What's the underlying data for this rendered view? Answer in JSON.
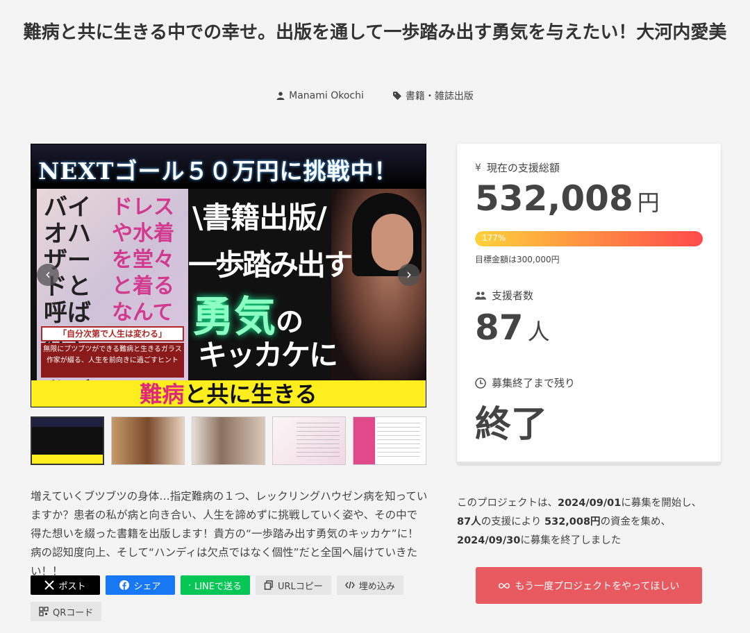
{
  "project": {
    "title": "難病と共に生きる中での幸せ。出版を通して一歩踏み出す勇気を与えたい！大河内愛美",
    "author": "Manami Okochi",
    "category": "書籍・雑誌出版"
  },
  "hero": {
    "top_text": "NEXTゴール５０万円に挑戦中！",
    "book_title_left": "バイオハザードと呼ばれていた私が",
    "book_title_right": "ドレスや水着を堂々と着るなんて",
    "book_banner": "「自分次第で人生は変わる」",
    "book_sub": "無限にブツブツができる難病と生きるガラス作家が綴る、人生を前向きに過ごすヒント",
    "line1": "\\書籍出版/",
    "line2": "一歩踏み出す",
    "line3": "勇気",
    "line3b": "の",
    "line4": "キッカケに",
    "bottom_red": "難病",
    "bottom_rest": "と共に生きる",
    "prev": "‹",
    "next": "›"
  },
  "stats": {
    "total_label": "現在の支援総額",
    "total_value": "532,008",
    "total_unit": "円",
    "progress_percent": 177,
    "progress_text": "177%",
    "target_text": "目標金額は300,000円",
    "backers_label": "支援者数",
    "backers_value": "87",
    "backers_unit": "人",
    "remaining_label": "募集終了まで残り",
    "remaining_value": "終了"
  },
  "summary": {
    "p1": "このプロジェクトは、",
    "start_date": "2024/09/01",
    "p2": "に募集を開始し、",
    "backers": "87人",
    "p3": "の支援により ",
    "amount": "532,008円",
    "p4": "の資金を集め、",
    "end_date": "2024/09/30",
    "p5": "に募集を終了しました"
  },
  "cta_label": "もう一度プロジェクトをやってほしい",
  "description": "増えていくブツブツの身体…指定難病の１つ、レックリングハウゼン病を知っていますか？患者の私が病と向き合い、人生を諦めずに挑戦していく姿や、その中で得た想いを綴った書籍を出版します！貴方の“一歩踏み出す勇気のキッカケ”に！病の認知度向上、そして“ハンディは欠点ではなく個性”だと全国へ届けていきたい！！",
  "share": {
    "x": "ポスト",
    "facebook": "シェア",
    "line": "LINEで送る",
    "url": "URLコピー",
    "embed": "埋め込み",
    "qr": "QRコード"
  },
  "colors": {
    "accent": "#e85a5f",
    "progress_start": "#ffd23a",
    "progress_end": "#ff4a4a"
  }
}
